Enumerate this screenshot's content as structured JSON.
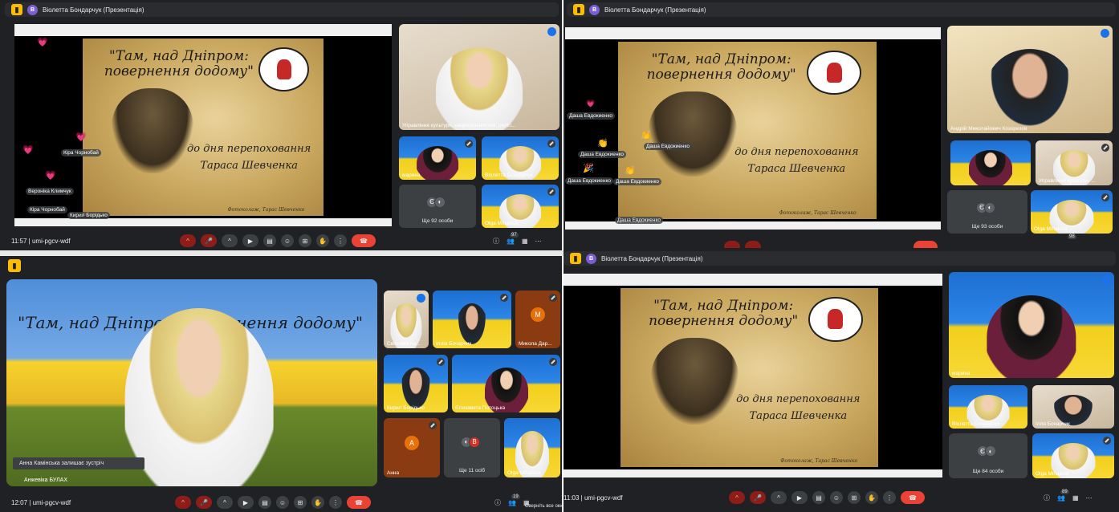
{
  "presenter": "Віолетта Бондарчук (Презентація)",
  "meeting_code": "umi-pgcv-wdf",
  "slide": {
    "title_line1": "\"Там, над Дніпром:",
    "title_line2": "повернення додому\"",
    "subtitle_line1": "до дня перепоховання",
    "subtitle_line2": "Тараса Шевченка",
    "signature": "Фотоколаж, Тарас Шевченко",
    "title_full": "\"Там, над Дніпром: повернення додому\""
  },
  "panels": [
    {
      "time": "11:57",
      "count": "97",
      "tiles": [
        {
          "name": "Управління культури, національностей, релігі..."
        },
        {
          "name": "марина"
        },
        {
          "name": "Віолетта Бондарчук"
        },
        {
          "name": "Ще 92 особи"
        },
        {
          "name": "Olga Mihaleva"
        }
      ],
      "reactions": [
        "Кіра Чорнобай",
        "Вероніка Климчук",
        "Кіра Чорнобай",
        "Кирил Борідько"
      ]
    },
    {
      "time": "",
      "count": "98",
      "tiles": [
        {
          "name": "Андрій Миколайович Козорезов"
        },
        {
          "name": ""
        },
        {
          "name": "Управління культури, ..."
        },
        {
          "name": "Ще 93 особи"
        },
        {
          "name": "Olga Mihaleva"
        }
      ],
      "reactions": [
        "Даша Евдокиенко",
        "Даша Евдокиенко",
        "Даша Евдокиенко",
        "Даша Евдокиенко",
        "Даша Евдокиенко"
      ]
    },
    {
      "time": "12:07",
      "count": "19",
      "main_overlay": "Анна Камінська залишає зустріч",
      "main_name": "Анжевіка БУЛАХ",
      "tiles": [
        {
          "name": "Світлана Ки..."
        },
        {
          "name": "Ілліа Бочарчик"
        },
        {
          "name": "Микола Дар..."
        },
        {
          "name": "Кирил Борідько"
        },
        {
          "name": "Єлизавета Потоцька"
        },
        {
          "name": "Анна"
        },
        {
          "name": "Ще 11 осіб"
        },
        {
          "name": "Olga Mihaleva"
        }
      ],
      "avatars": [
        "М",
        "А",
        "В"
      ]
    },
    {
      "time": "11:03",
      "count": "89",
      "tiles": [
        {
          "name": "марина"
        },
        {
          "name": "Віолетта Бондарчук"
        },
        {
          "name": "Ілля Бочарчик"
        },
        {
          "name": "Ще 84 особи"
        },
        {
          "name": "Olga Mihaleva"
        }
      ]
    }
  ],
  "hint": "Сверніть все окна",
  "colors": {
    "meet_bg": "#202124",
    "tile_bg": "#3c4043",
    "leave_red": "#ea4335",
    "accent_yellow": "#fbbc04"
  }
}
